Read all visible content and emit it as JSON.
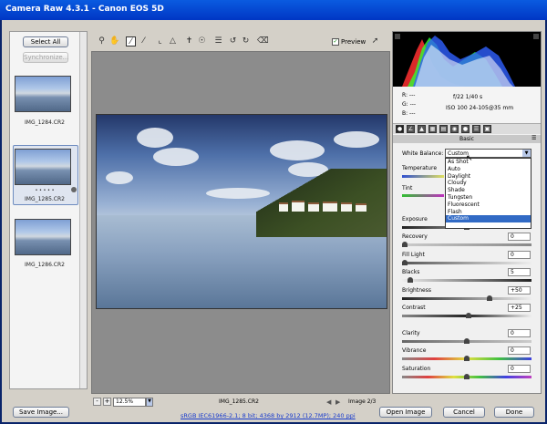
{
  "window": {
    "title": "Camera Raw 4.3.1  -  Canon EOS 5D"
  },
  "filmstrip": {
    "select_all": "Select All",
    "synchronize": "Synchronize...",
    "thumbnails": [
      {
        "label": "IMG_1284.CR2"
      },
      {
        "label": "IMG_1285.CR2",
        "rating": "• • • • •"
      },
      {
        "label": "IMG_1286.CR2"
      }
    ]
  },
  "toolbar": {
    "tools": [
      "zoom-tool",
      "hand-tool",
      "white-balance-tool",
      "color-sampler-tool",
      "crop-tool",
      "straighten-tool",
      "spot-removal-tool",
      "red-eye-tool",
      "preferences",
      "rotate-left",
      "rotate-right",
      "trash"
    ],
    "preview_label": "Preview",
    "preview_checked": true
  },
  "statusbar": {
    "zoom": "12.5%",
    "filename": "IMG_1285.CR2",
    "image_count": "Image 2/3"
  },
  "info": {
    "r": "R:  ---",
    "g": "G:  ---",
    "b": "B:  ---",
    "aperture_shutter": "f/22    1/40 s",
    "iso_lens": "ISO 100    24-105@35 mm"
  },
  "panel": {
    "title": "Basic",
    "white_balance_label": "White Balance:",
    "white_balance_value": "Custom",
    "white_balance_options": [
      "As Shot",
      "Auto",
      "Daylight",
      "Cloudy",
      "Shade",
      "Tungsten",
      "Fluorescent",
      "Flash",
      "Custom"
    ],
    "temperature_label": "Temperature",
    "tint_label": "Tint",
    "sliders": [
      {
        "label": "Exposure",
        "value": ""
      },
      {
        "label": "Recovery",
        "value": "0"
      },
      {
        "label": "Fill Light",
        "value": "0"
      },
      {
        "label": "Blacks",
        "value": "5"
      },
      {
        "label": "Brightness",
        "value": "+50"
      },
      {
        "label": "Contrast",
        "value": "+25"
      },
      {
        "label": "Clarity",
        "value": "0"
      },
      {
        "label": "Vibrance",
        "value": "0"
      },
      {
        "label": "Saturation",
        "value": "0"
      }
    ]
  },
  "footer": {
    "save": "Save Image...",
    "workflow_link": "sRGB IEC61966-2.1; 8 bit; 4368 by 2912 (12.7MP); 240 ppi",
    "open": "Open Image",
    "cancel": "Cancel",
    "done": "Done"
  }
}
